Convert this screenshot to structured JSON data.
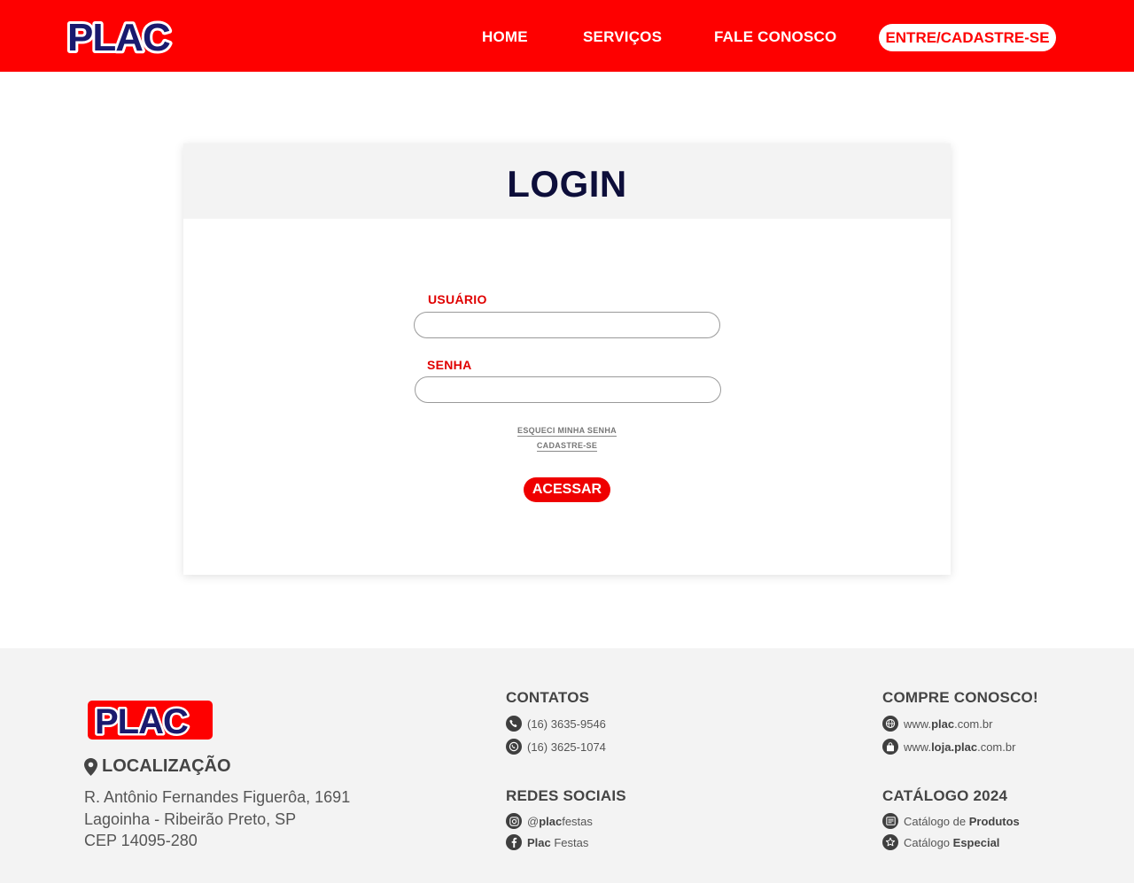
{
  "header": {
    "logo_text": "PLAC",
    "nav": {
      "home": "HOME",
      "servicos": "SERVIÇOS",
      "fale": "FALE CONOSCO",
      "cta": "ENTRE/CADASTRE-SE"
    }
  },
  "login": {
    "title": "LOGIN",
    "user_label": "USUÁRIO",
    "user_value": "",
    "pass_label": "SENHA",
    "pass_value": "",
    "forgot_link": "ESQUECI MINHA SENHA",
    "signup_link": "CADASTRE-SE",
    "submit": "ACESSAR"
  },
  "footer": {
    "logo_text": "PLAC",
    "location": {
      "title": "LOCALIZAÇÃO",
      "line1": "R. Antônio Fernandes Figuerôa, 1691",
      "line2": "Lagoinha - Ribeirão Preto, SP",
      "line3": "CEP 14095-280"
    },
    "contacts": {
      "title": "CONTATOS",
      "phone": "(16) 3635-9546",
      "whatsapp": "(16) 3625-1074"
    },
    "social": {
      "title": "REDES SOCIAIS",
      "instagram_prefix": "@",
      "instagram_bold": "plac",
      "instagram_suffix": "festas",
      "facebook_bold": "Plac",
      "facebook_suffix": " Festas"
    },
    "buy": {
      "title": "COMPRE CONOSCO!",
      "site_prefix": "www.",
      "site_bold": "plac",
      "site_suffix": ".com.br",
      "store_prefix": "www.",
      "store_bold": "loja.plac",
      "store_suffix": ".com.br"
    },
    "catalog": {
      "title": "CATÁLOGO 2024",
      "products_prefix": "Catálogo de ",
      "products_bold": "Produtos",
      "special_prefix": "Catálogo ",
      "special_bold": "Especial"
    }
  },
  "colors": {
    "brand_red": "#fe0000",
    "brand_navy": "#0d0e3a",
    "footer_bg": "#f3f3f3"
  }
}
